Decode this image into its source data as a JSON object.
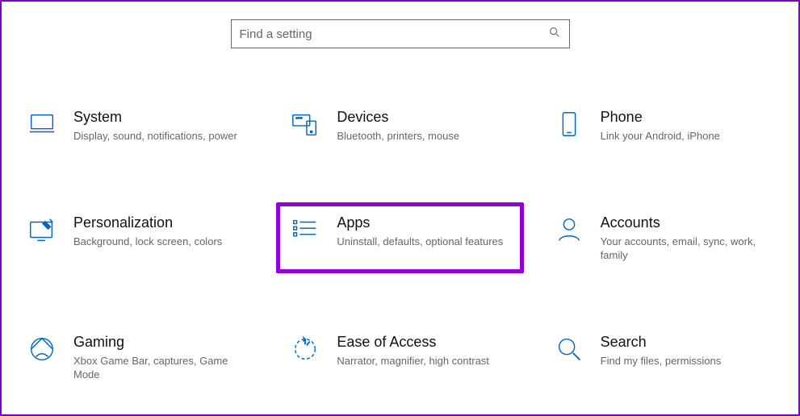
{
  "search": {
    "placeholder": "Find a setting"
  },
  "tiles": {
    "system": {
      "title": "System",
      "desc": "Display, sound, notifications, power"
    },
    "devices": {
      "title": "Devices",
      "desc": "Bluetooth, printers, mouse"
    },
    "phone": {
      "title": "Phone",
      "desc": "Link your Android, iPhone"
    },
    "personalization": {
      "title": "Personalization",
      "desc": "Background, lock screen, colors"
    },
    "apps": {
      "title": "Apps",
      "desc": "Uninstall, defaults, optional features"
    },
    "accounts": {
      "title": "Accounts",
      "desc": "Your accounts, email, sync, work, family"
    },
    "gaming": {
      "title": "Gaming",
      "desc": "Xbox Game Bar, captures, Game Mode"
    },
    "ease": {
      "title": "Ease of Access",
      "desc": "Narrator, magnifier, high contrast"
    },
    "search": {
      "title": "Search",
      "desc": "Find my files, permissions"
    }
  }
}
